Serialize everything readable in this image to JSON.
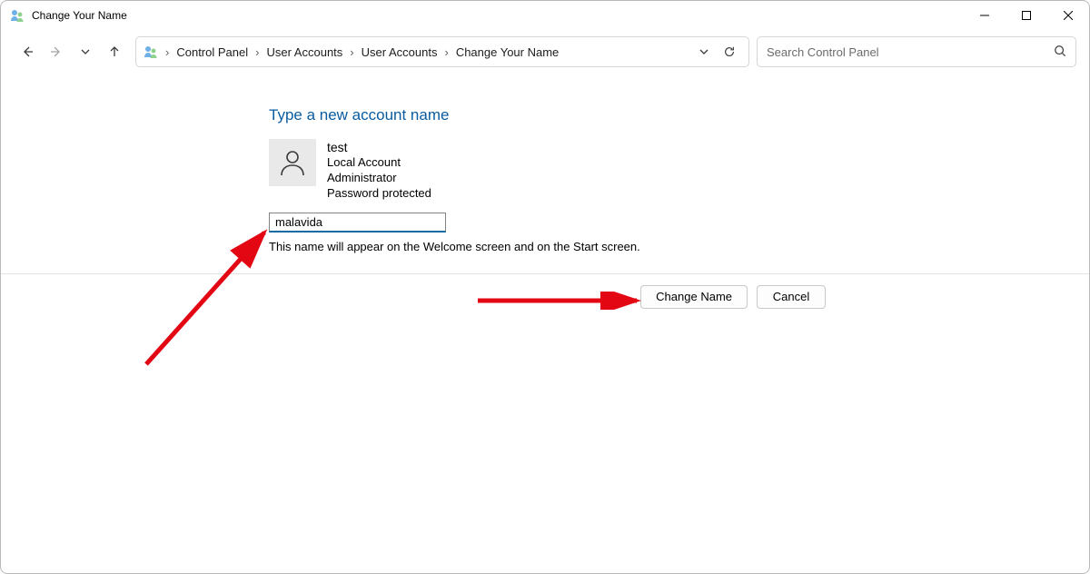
{
  "window": {
    "title": "Change Your Name"
  },
  "breadcrumb": {
    "root": "Control Panel",
    "level1": "User Accounts",
    "level2": "User Accounts",
    "level3": "Change Your Name"
  },
  "search": {
    "placeholder": "Search Control Panel"
  },
  "page": {
    "heading": "Type a new account name",
    "account": {
      "name": "test",
      "type": "Local Account",
      "role": "Administrator",
      "protection": "Password protected"
    },
    "input_value": "malavida",
    "helper": "This name will appear on the Welcome screen and on the Start screen."
  },
  "buttons": {
    "change": "Change Name",
    "cancel": "Cancel"
  }
}
